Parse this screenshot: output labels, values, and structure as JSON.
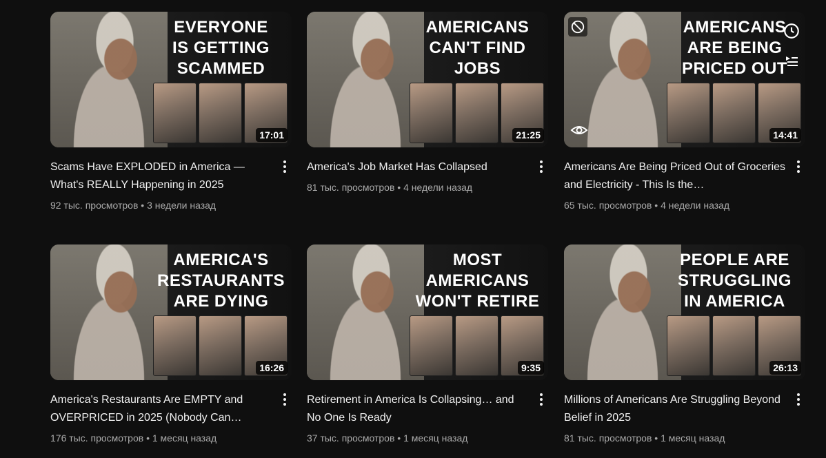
{
  "videos": [
    {
      "caption_lines": [
        "EVERYONE",
        "IS GETTING",
        "SCAMMED"
      ],
      "duration": "17:01",
      "title": "Scams Have EXPLODED in America — What's REALLY Happening in 2025",
      "views": "92 тыс. просмотров",
      "age": "3 недели назад"
    },
    {
      "caption_lines": [
        "AMERICANS",
        "CAN'T FIND",
        "JOBS"
      ],
      "duration": "21:25",
      "title": "America's Job Market Has Collapsed",
      "views": "81 тыс. просмотров",
      "age": "4 недели назад"
    },
    {
      "caption_lines": [
        "AMERICANS",
        "ARE BEING",
        "PRICED OUT"
      ],
      "duration": "14:41",
      "title": "Americans Are Being Priced Out of Groceries and Electricity - This Is the…",
      "views": "65 тыс. просмотров",
      "age": "4 недели назад"
    },
    {
      "caption_lines": [
        "AMERICA'S",
        "RESTAURANTS",
        "ARE DYING"
      ],
      "duration": "16:26",
      "title": "America's Restaurants Are EMPTY and OVERPRICED in 2025 (Nobody Can…",
      "views": "176 тыс. просмотров",
      "age": "1 месяц назад"
    },
    {
      "caption_lines": [
        "MOST",
        "AMERICANS",
        "WON'T RETIRE"
      ],
      "duration": "9:35",
      "title": "Retirement in America Is Collapsing… and No One Is Ready",
      "views": "37 тыс. просмотров",
      "age": "1 месяц назад"
    },
    {
      "caption_lines": [
        "PEOPLE ARE",
        "STRUGGLING",
        "IN AMERICA"
      ],
      "duration": "26:13",
      "title": "Millions of Americans Are Struggling Beyond Belief in 2025",
      "views": "81 тыс. просмотров",
      "age": "1 месяц назад"
    }
  ],
  "separator": "•",
  "hover_overlay_icons": [
    "not-interested-icon",
    "watch-later-clock-icon",
    "add-to-queue-icon",
    "preview-eye-icon"
  ],
  "colors": {
    "background": "#0f0f0f",
    "title": "#f1f1f1",
    "meta": "#aaaaaa",
    "duration_bg": "#000000cc"
  }
}
